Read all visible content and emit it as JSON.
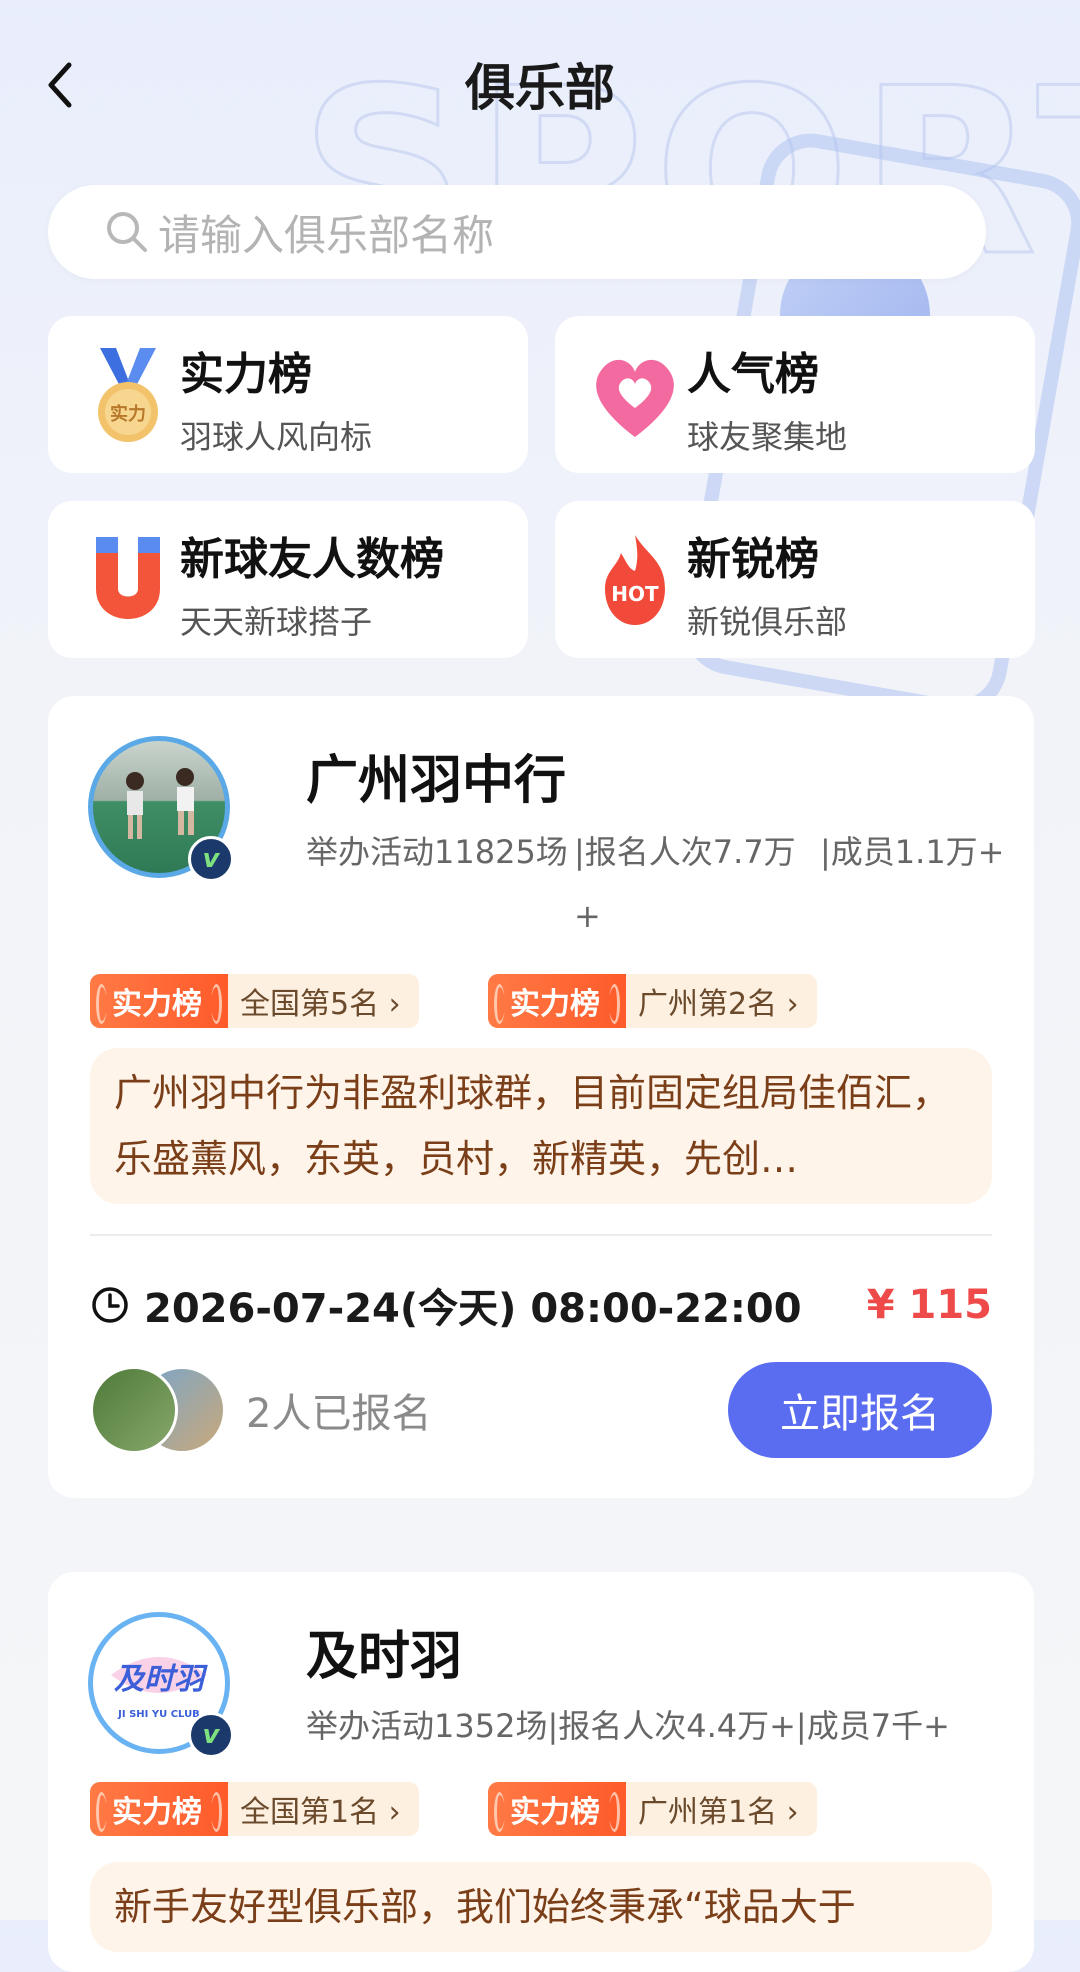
{
  "header": {
    "title": "俱乐部"
  },
  "search": {
    "placeholder": "请输入俱乐部名称"
  },
  "rankings": [
    {
      "name": "实力榜",
      "subtitle": "羽球人风向标",
      "icon": "medal-icon"
    },
    {
      "name": "人气榜",
      "subtitle": "球友聚集地",
      "icon": "heart-icon"
    },
    {
      "name": "新球友人数榜",
      "subtitle": "天天新球搭子",
      "icon": "magnet-icon"
    },
    {
      "name": "新锐榜",
      "subtitle": "新锐俱乐部",
      "icon": "hot-fire-icon"
    }
  ],
  "clubs": [
    {
      "name": "广州羽中行",
      "stats": [
        "举办活动11825场",
        "|报名人次7.7万+",
        "|成员1.1万+"
      ],
      "tags": [
        {
          "label": "实力榜",
          "value": "全国第5名 ›"
        },
        {
          "label": "实力榜",
          "value": "广州第2名 ›"
        }
      ],
      "description": "广州羽中行为非盈利球群，目前固定组局佳佰汇，乐盛薰风，东英，员村，新精英，先创…",
      "activity_time": "2026-07-24(今天) 08:00-22:00",
      "price": "¥ 115",
      "signed_up": "2人已报名",
      "button": "立即报名"
    },
    {
      "name": "及时羽",
      "logo_text": "及时羽",
      "logo_sub": "JI SHI YU CLUB",
      "stats": [
        "举办活动1352场|报名人次4.4万+|成员7千+"
      ],
      "tags": [
        {
          "label": "实力榜",
          "value": "全国第1名 ›"
        },
        {
          "label": "实力榜",
          "value": "广州第1名 ›"
        }
      ],
      "description": "新手友好型俱乐部，我们始终秉承“球品大于"
    }
  ],
  "colors": {
    "accent": "#5a6df0",
    "price": "#ef4a4a",
    "tag": "#ff6a35"
  }
}
